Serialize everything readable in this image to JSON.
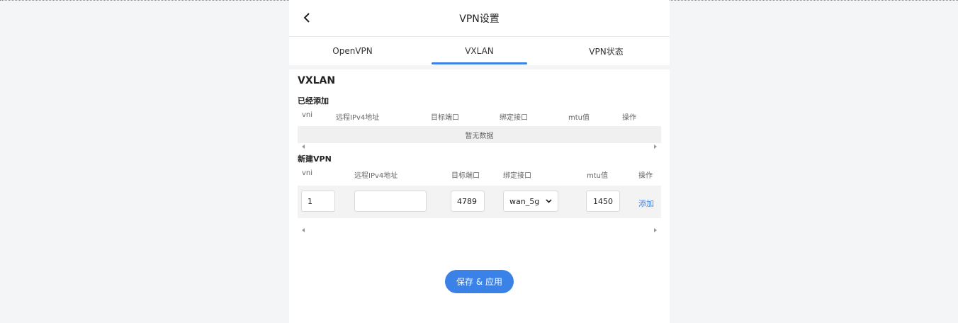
{
  "header": {
    "title": "VPN设置"
  },
  "tabs": [
    {
      "label": "OpenVPN"
    },
    {
      "label": "VXLAN"
    },
    {
      "label": "VPN状态"
    }
  ],
  "section": {
    "title": "VXLAN"
  },
  "added": {
    "title": "已经添加",
    "columns": [
      "vni",
      "远程IPv4地址",
      "目标端口",
      "绑定接口",
      "mtu值",
      "操作"
    ],
    "empty_text": "暂无数据"
  },
  "new_vpn": {
    "title": "新建VPN",
    "columns": [
      "vni",
      "远程IPv4地址",
      "目标端口",
      "绑定接口",
      "mtu值",
      "操作"
    ],
    "vni": "1",
    "remote_ip": "",
    "port": "4789",
    "interface": "wan_5g",
    "mtu": "1450",
    "add_label": "添加"
  },
  "save_label": "保存 & 应用",
  "colors": {
    "accent": "#3b82e8"
  }
}
